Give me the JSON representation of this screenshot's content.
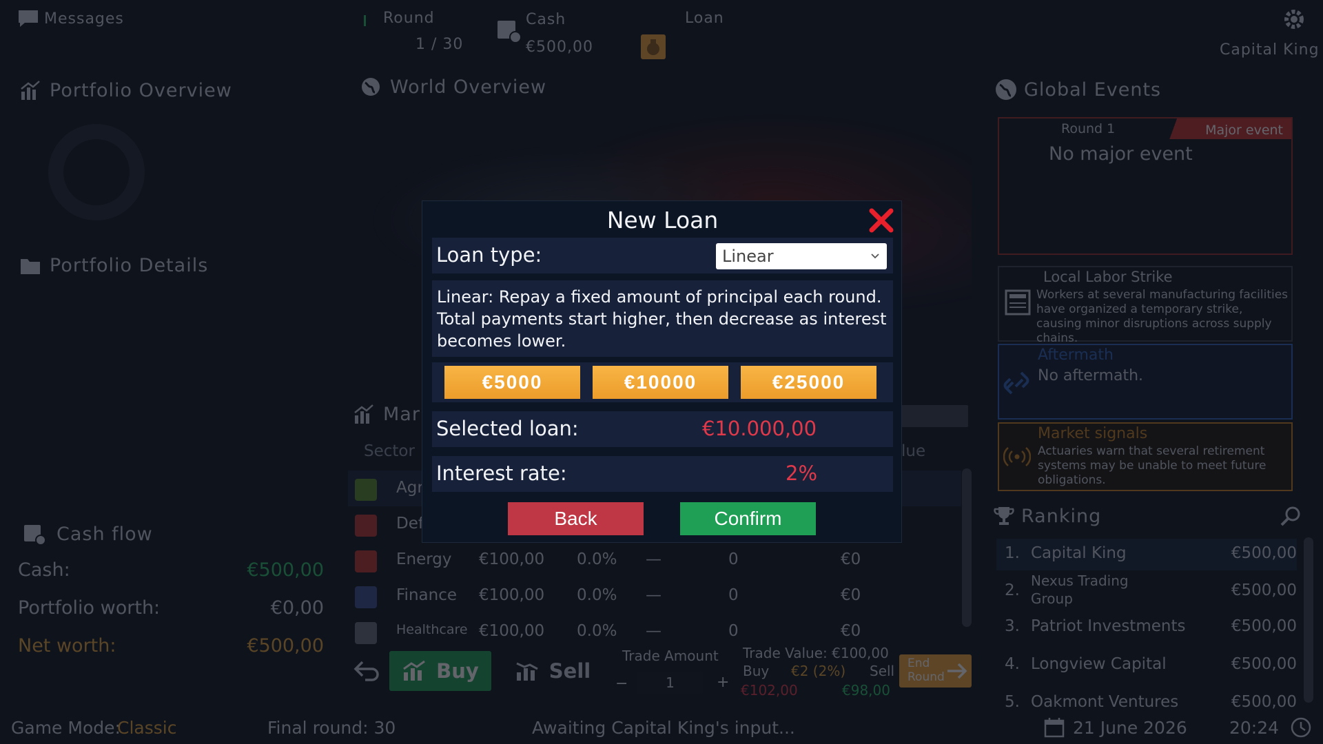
{
  "topbar": {
    "messages_label": "Messages",
    "round_label": "Round",
    "round_value": "1 / 30",
    "cash_label": "Cash",
    "cash_value": "€500,00",
    "loan_label": "Loan",
    "player_name": "Capital King"
  },
  "left": {
    "portfolio_overview": "Portfolio Overview",
    "portfolio_details": "Portfolio Details",
    "cash_flow_title": "Cash flow",
    "cash_label": "Cash:",
    "cash_value": "€500,00",
    "portfolio_worth_label": "Portfolio worth:",
    "portfolio_worth_value": "€0,00",
    "net_worth_label": "Net worth:",
    "net_worth_value": "€500,00"
  },
  "center": {
    "world_overview": "World Overview",
    "market_title_partial": "Mar",
    "col_sector": "Sector",
    "col_value_partial": "lue",
    "rows": [
      {
        "sector": "Agric",
        "price": "",
        "change": "",
        "trend": "",
        "owned": "",
        "value": "",
        "icon_color": "#5b8c2a"
      },
      {
        "sector": "Def",
        "price": "",
        "change": "",
        "trend": "",
        "owned": "",
        "value": "",
        "icon_color": "#b8332e"
      },
      {
        "sector": "Energy",
        "price": "€100,00",
        "change": "0.0%",
        "trend": "—",
        "owned": "0",
        "value": "€0",
        "icon_color": "#c2352c"
      },
      {
        "sector": "Finance",
        "price": "€100,00",
        "change": "0.0%",
        "trend": "—",
        "owned": "0",
        "value": "€0",
        "icon_color": "#3b4c8c"
      },
      {
        "sector": "Healthcare",
        "price": "€100,00",
        "change": "0.0%",
        "trend": "—",
        "owned": "0",
        "value": "€0",
        "icon_color": "#6a6e78"
      }
    ],
    "buy_label": "Buy",
    "sell_label": "Sell",
    "trade_amount_label": "Trade Amount",
    "trade_amount_value": "1",
    "trade_minus": "−",
    "trade_plus": "+",
    "trade_value_label": "Trade Value: €100,00",
    "buy_short": "Buy",
    "fee": "€2 (2%)",
    "sell_short": "Sell",
    "buy_total": "€102,00",
    "sell_total": "€98,00",
    "end_round": "End Round"
  },
  "right": {
    "global_events": "Global Events",
    "event_round": "Round 1",
    "major_event_tag": "Major event",
    "major_event_text": "No major event",
    "local_title": "Local Labor Strike",
    "local_text": "Workers at several manufacturing facilities have organized a temporary strike, causing minor disruptions across supply chains.",
    "aftermath_title": "Aftermath",
    "aftermath_text": "No aftermath.",
    "signals_title": "Market signals",
    "signals_text": "Actuaries warn that several retirement systems may be unable to meet future obligations.",
    "ranking_title": "Ranking",
    "ranking": [
      {
        "pos": "1.",
        "name": "Capital King",
        "value": "€500,00"
      },
      {
        "pos": "2.",
        "name": "Nexus Trading Group",
        "value": "€500,00"
      },
      {
        "pos": "3.",
        "name": "Patriot Investments",
        "value": "€500,00"
      },
      {
        "pos": "4.",
        "name": "Longview Capital",
        "value": "€500,00"
      },
      {
        "pos": "5.",
        "name": "Oakmont Ventures",
        "value": "€500,00"
      }
    ]
  },
  "modal": {
    "title": "New Loan",
    "loan_type_label": "Loan type:",
    "loan_type_value": "Linear",
    "description": "Linear: Repay a fixed amount of principal each round. Total payments start higher, then decrease as interest becomes lower.",
    "amounts": [
      "€5000",
      "€10000",
      "€25000"
    ],
    "selected_label": "Selected loan:",
    "selected_value": "€10.000,00",
    "interest_label": "Interest rate:",
    "interest_value": "2%",
    "back": "Back",
    "confirm": "Confirm"
  },
  "bottombar": {
    "game_mode_label": "Game Mode:",
    "game_mode_value": "Classic",
    "final_round": "Final round: 30",
    "status": "Awaiting Capital King's input...",
    "date": "21 June 2026",
    "time": "20:24"
  },
  "colors": {
    "accent_orange": "#f0a23a",
    "confirm_green": "#1f9e55",
    "back_red": "#bf3744",
    "value_red": "#e2394a"
  }
}
